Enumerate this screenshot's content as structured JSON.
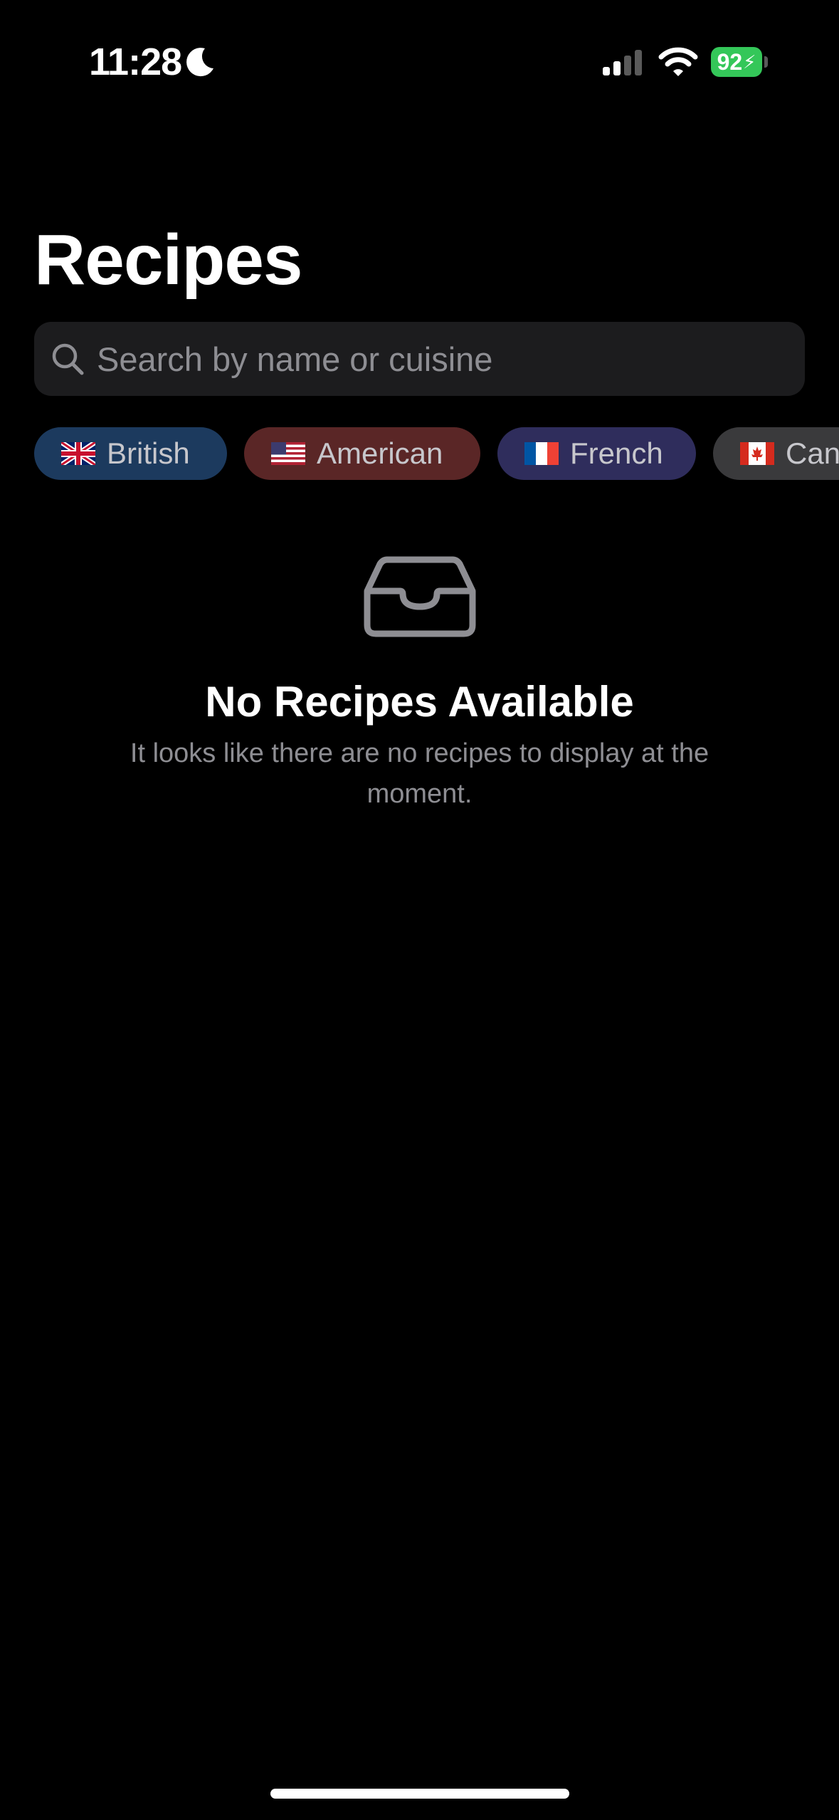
{
  "status_bar": {
    "time": "11:28",
    "focus_icon": "moon-icon",
    "signal_icon": "cellular-signal-icon",
    "wifi_icon": "wifi-icon",
    "battery_level": "92",
    "battery_charging": true,
    "battery_color": "#34c759"
  },
  "page": {
    "title": "Recipes"
  },
  "search": {
    "placeholder": "Search by name or cuisine",
    "value": "",
    "icon": "search-icon"
  },
  "cuisine_filters": [
    {
      "label": "British",
      "flag": "uk-flag-icon",
      "background": "#1c3a5e"
    },
    {
      "label": "American",
      "flag": "us-flag-icon",
      "background": "#5a2626"
    },
    {
      "label": "French",
      "flag": "france-flag-icon",
      "background": "#2f2d5c"
    },
    {
      "label": "Can",
      "flag": "canada-flag-icon",
      "background": "#3a3a3c"
    }
  ],
  "empty_state": {
    "icon": "tray-icon",
    "title": "No Recipes Available",
    "message": "It looks like there are no recipes to display at the moment."
  },
  "colors": {
    "background": "#000000",
    "search_background": "#1c1c1e",
    "secondary_text": "#8e8e93"
  }
}
